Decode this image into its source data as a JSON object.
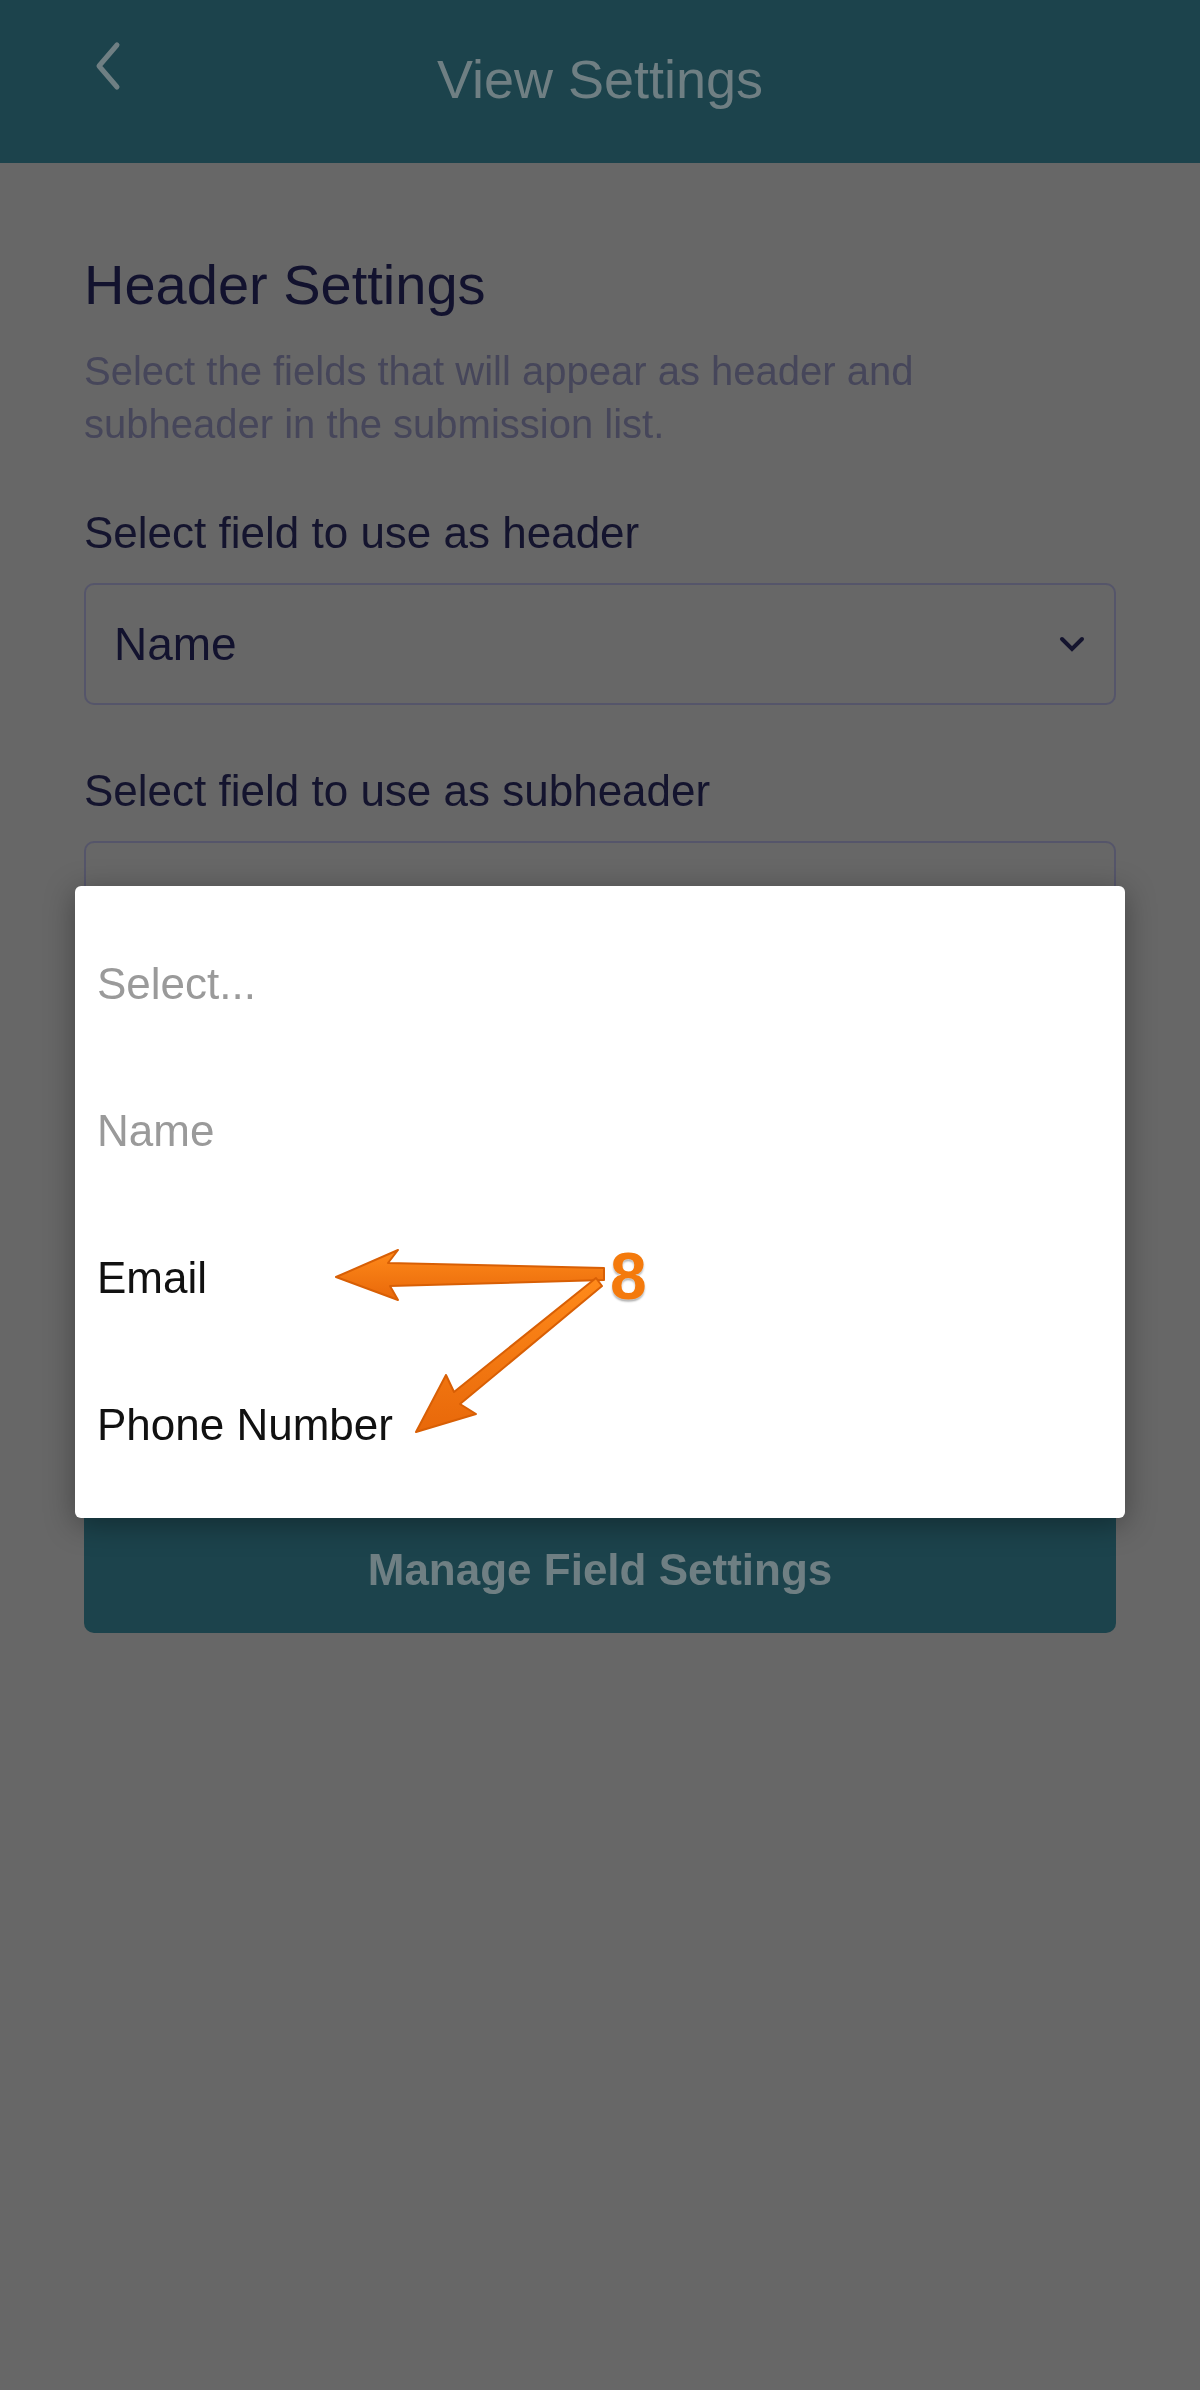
{
  "app_bar": {
    "title": "View Settings"
  },
  "section": {
    "title": "Header Settings",
    "description": "Select the fields that will appear as header and subheader in the submission list."
  },
  "fields": [
    {
      "label": "Select field to use as header",
      "value": "Name"
    },
    {
      "label": "Select field to use as subheader"
    }
  ],
  "primary_button": {
    "label": "Manage Field Settings"
  },
  "dropdown_options": [
    {
      "label": "Select...",
      "disabled": true
    },
    {
      "label": "Name",
      "disabled": true
    },
    {
      "label": "Email",
      "disabled": false
    },
    {
      "label": "Phone Number",
      "disabled": false
    }
  ],
  "annotation": {
    "label": "8"
  }
}
